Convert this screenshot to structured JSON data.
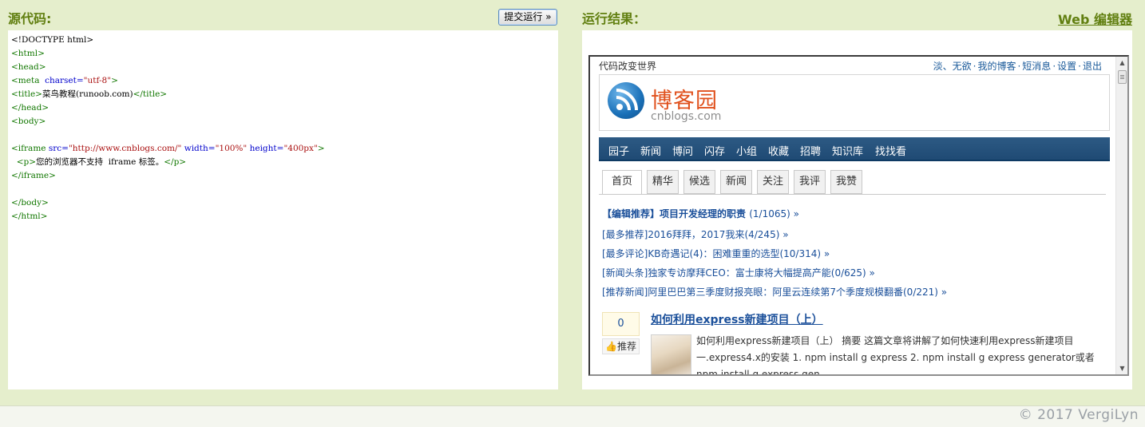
{
  "left_panel": {
    "title": "源代码:",
    "submit_label": "提交运行 »"
  },
  "right_panel": {
    "title": "运行结果：",
    "web_editor_link": "Web 编辑器"
  },
  "code_lines": [
    [
      {
        "t": "<!DOCTYPE html>",
        "c": "plain"
      }
    ],
    [
      {
        "t": "<html>",
        "c": "tag"
      }
    ],
    [
      {
        "t": "<head>",
        "c": "tag"
      }
    ],
    [
      {
        "t": "<meta  ",
        "c": "tag"
      },
      {
        "t": "charset=",
        "c": "attr"
      },
      {
        "t": "\"utf-8\"",
        "c": "str"
      },
      {
        "t": ">",
        "c": "tag"
      }
    ],
    [
      {
        "t": "<title>",
        "c": "tag"
      },
      {
        "t": "菜鸟教程(runoob.com)",
        "c": "plain"
      },
      {
        "t": "</title>",
        "c": "tag"
      }
    ],
    [
      {
        "t": "</head>",
        "c": "tag"
      }
    ],
    [
      {
        "t": "<body>",
        "c": "tag"
      }
    ],
    [
      {
        "t": "",
        "c": "plain"
      }
    ],
    [
      {
        "t": "<iframe ",
        "c": "tag"
      },
      {
        "t": "src=",
        "c": "attr"
      },
      {
        "t": "\"http://www.cnblogs.com/\"",
        "c": "str"
      },
      {
        "t": " width=",
        "c": "attr"
      },
      {
        "t": "\"100%\"",
        "c": "str"
      },
      {
        "t": " height=",
        "c": "attr"
      },
      {
        "t": "\"400px\"",
        "c": "str"
      },
      {
        "t": ">",
        "c": "tag"
      }
    ],
    [
      {
        "t": "  ",
        "c": "plain"
      },
      {
        "t": "<p>",
        "c": "tag"
      },
      {
        "t": "您的浏览器不支持  iframe 标签。",
        "c": "plain"
      },
      {
        "t": "</p>",
        "c": "tag"
      }
    ],
    [
      {
        "t": "</iframe>",
        "c": "tag"
      }
    ],
    [
      {
        "t": "",
        "c": "plain"
      }
    ],
    [
      {
        "t": "</body>",
        "c": "tag"
      }
    ],
    [
      {
        "t": "</html>",
        "c": "tag"
      }
    ]
  ],
  "site": {
    "slogan": "代码改变世界",
    "user_links": [
      "淡、无欲",
      "我的博客",
      "短消息",
      "设置",
      "退出"
    ],
    "logo_text": "博客园",
    "logo_sub": "cnblogs.com",
    "nav_items": [
      "园子",
      "新闻",
      "博问",
      "闪存",
      "小组",
      "收藏",
      "招聘",
      "知识库",
      "找找看"
    ],
    "tabs": [
      "首页",
      "精华",
      "候选",
      "新闻",
      "关注",
      "我评",
      "我赞"
    ],
    "editor_pick": {
      "label": "【编辑推荐】项目开发经理的职责",
      "count": "(1/1065) »"
    },
    "news": [
      "[最多推荐]2016拜拜，2017我来(4/245) »",
      "[最多评论]KB奇遇记(4)：困难重重的选型(10/314) »",
      "[新闻头条]独家专访摩拜CEO：富士康将大幅提高产能(0/625) »",
      "[推荐新闻]阿里巴巴第三季度财报亮眼：阿里云连续第7个季度规模翻番(0/221) »"
    ],
    "post": {
      "votes": "0",
      "recommend_label": "推荐",
      "title": "如何利用express新建项目（上）",
      "summary": "如何利用express新建项目（上） 摘要 这篇文章将讲解了如何快速利用express新建项目一.express4.x的安装 1. npm install g express 2. npm install g express generator或者npm install g express gen..."
    }
  },
  "watermark": "© 2017 VergiLyn"
}
